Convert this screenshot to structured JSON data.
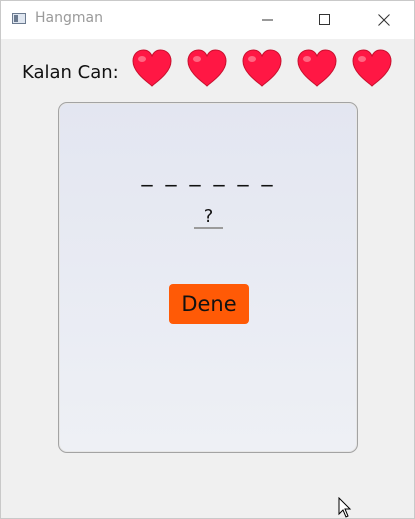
{
  "window": {
    "title": "Hangman",
    "controls": {
      "minimize_icon": "minimize-icon",
      "maximize_icon": "maximize-icon",
      "close_icon": "close-icon"
    }
  },
  "lives": {
    "label": "Kalan Can:",
    "count": 5,
    "heart_color": "#ff1744",
    "heart_icon": "heart-icon"
  },
  "game": {
    "masked_word": "_ _ _ _ _ _",
    "guess_value": "?",
    "try_button_label": "Dene",
    "try_button_color": "#ff5a06"
  }
}
